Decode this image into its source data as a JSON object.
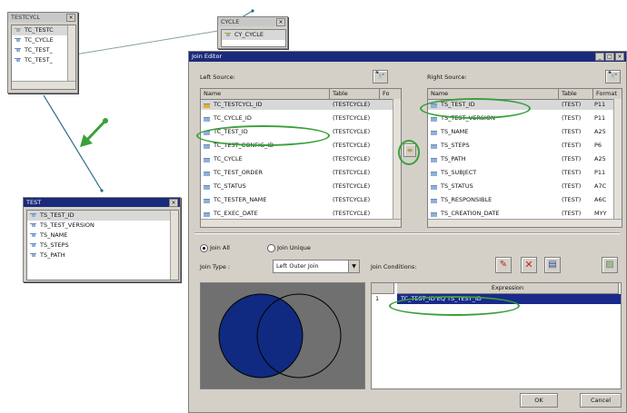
{
  "testcycl_window": {
    "title": "TESTCYCL",
    "items": [
      "TC_TESTC",
      "TC_CYCLE",
      "TC_TEST_",
      "TC_TEST_"
    ]
  },
  "cycle_window": {
    "title": "CYCLE",
    "items": [
      "CY_CYCLE"
    ]
  },
  "test_window": {
    "title": "TEST",
    "items": [
      "TS_TEST_ID",
      "TS_TEST_VERSION",
      "TS_NAME",
      "TS_STEPS",
      "TS_PATH"
    ]
  },
  "join_editor": {
    "title": "Join Editor",
    "left_source_label": "Left Source:",
    "right_source_label": "Right Source:",
    "left_columns": [
      "Name",
      "Table",
      "Fo"
    ],
    "right_columns": [
      "Name",
      "Table",
      "Format"
    ],
    "left_rows": [
      {
        "name": "TC_TESTCYCL_ID",
        "table": "(TESTCYCLE)"
      },
      {
        "name": "TC_CYCLE_ID",
        "table": "(TESTCYCLE)"
      },
      {
        "name": "TC_TEST_ID",
        "table": "(TESTCYCLE)"
      },
      {
        "name": "TC_TEST_CONFIG_ID",
        "table": "(TESTCYCLE)"
      },
      {
        "name": "TC_CYCLE",
        "table": "(TESTCYCLE)"
      },
      {
        "name": "TC_TEST_ORDER",
        "table": "(TESTCYCLE)"
      },
      {
        "name": "TC_STATUS",
        "table": "(TESTCYCLE)"
      },
      {
        "name": "TC_TESTER_NAME",
        "table": "(TESTCYCLE)"
      },
      {
        "name": "TC_EXEC_DATE",
        "table": "(TESTCYCLE)"
      }
    ],
    "right_rows": [
      {
        "name": "TS_TEST_ID",
        "table": "(TEST)",
        "format": "P11"
      },
      {
        "name": "TS_TEST_VERSION",
        "table": "(TEST)",
        "format": "P11"
      },
      {
        "name": "TS_NAME",
        "table": "(TEST)",
        "format": "A25"
      },
      {
        "name": "TS_STEPS",
        "table": "(TEST)",
        "format": "P6"
      },
      {
        "name": "TS_PATH",
        "table": "(TEST)",
        "format": "A25"
      },
      {
        "name": "TS_SUBJECT",
        "table": "(TEST)",
        "format": "P11"
      },
      {
        "name": "TS_STATUS",
        "table": "(TEST)",
        "format": "A7C"
      },
      {
        "name": "TS_RESPONSIBLE",
        "table": "(TEST)",
        "format": "A6C"
      },
      {
        "name": "TS_CREATION_DATE",
        "table": "(TEST)",
        "format": "MYY"
      }
    ],
    "join_all_label": "Join All",
    "join_unique_label": "Join Unique",
    "join_type_label": "Join Type :",
    "join_type_value": "Left Outer Join",
    "join_conditions_label": "Join Conditions:",
    "expression_header": "Expression",
    "condition_row_number": "1",
    "condition_expression": "TC_TEST_ID EQ TS_TEST_ID",
    "ok_label": "OK",
    "cancel_label": "Cancel"
  },
  "colors": {
    "accent_green": "#3aa03a",
    "title_blue": "#1a2a7a",
    "venn_fill": "#0f2a80"
  }
}
